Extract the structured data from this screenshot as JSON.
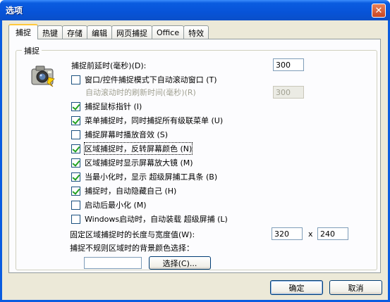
{
  "window": {
    "title": "选项",
    "close_symbol": "✕"
  },
  "tabs": [
    {
      "label": "捕捉",
      "active": true
    },
    {
      "label": "热键"
    },
    {
      "label": "存储"
    },
    {
      "label": "编辑"
    },
    {
      "label": "网页捕捉"
    },
    {
      "label": "Office"
    },
    {
      "label": "特效"
    }
  ],
  "group": {
    "title": "捕捉"
  },
  "delay": {
    "label": "捕捉前延时(毫秒)(D):",
    "value": "300"
  },
  "auto_scroll": {
    "label": "窗口/控件捕捉模式下自动滚动窗口 (T)",
    "checked": false
  },
  "refresh": {
    "label": "自动滚动时的刷新时间(毫秒)(R)",
    "value": "300"
  },
  "options": [
    {
      "label": "捕捉鼠标指针 (I)",
      "checked": true
    },
    {
      "label": "菜单捕捉时，同时捕捉所有级联菜单 (U)",
      "checked": true
    },
    {
      "label": "捕捉屏幕时播放音效 (S)",
      "checked": false
    },
    {
      "label": "区域捕捉时，反转屏幕颜色 (N)",
      "checked": true
    },
    {
      "label": "区域捕捉时显示屏幕放大镜 (M)",
      "checked": true
    },
    {
      "label": "当最小化时，显示 超级屏捕工具条 (B)",
      "checked": true
    },
    {
      "label": "捕捉时，自动隐藏自己 (H)",
      "checked": true
    },
    {
      "label": "启动后最小化 (M)",
      "checked": false
    },
    {
      "label": "Windows启动时，自动装载 超级屏捕 (L)",
      "checked": false
    }
  ],
  "fixed_region": {
    "label": "固定区域捕捉时的长度与宽度值(W):",
    "width": "320",
    "separator": "x",
    "height": "240"
  },
  "bg_color": {
    "label": "捕捉不规则区域时的背景颜色选择：",
    "value": "",
    "button_label": "选择(C)..."
  },
  "dialog_buttons": {
    "ok": "确定",
    "cancel": "取消"
  },
  "icons": {
    "camera": "camera-icon"
  }
}
